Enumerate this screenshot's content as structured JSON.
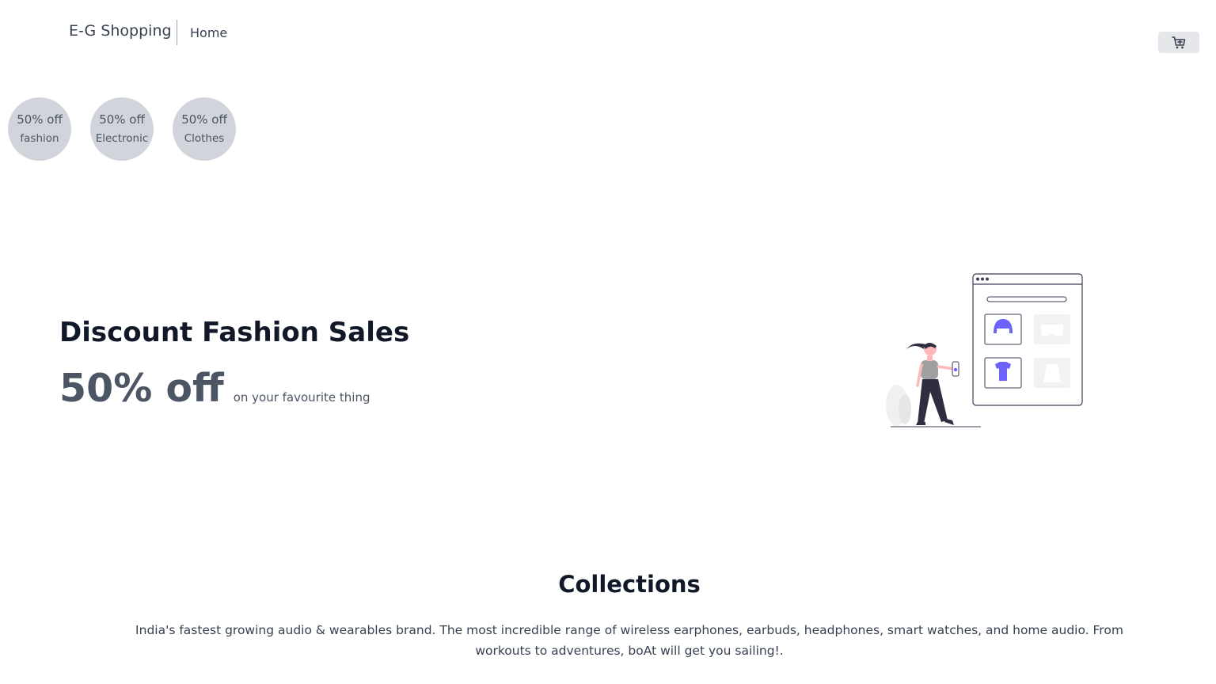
{
  "header": {
    "brand": "E-G Shopping",
    "nav": [
      {
        "label": "Home"
      }
    ],
    "cart_icon": "cart-plus-icon"
  },
  "discounts": [
    {
      "offer": "50% off",
      "category": "fashion"
    },
    {
      "offer": "50% off",
      "category": "Electronic"
    },
    {
      "offer": "50% off",
      "category": "Clothes"
    }
  ],
  "hero": {
    "title": "Discount Fashion Sales",
    "offer": "50% off",
    "offer_sub": "on your favourite thing",
    "accent_color": "#6c63ff"
  },
  "collections": {
    "title": "Collections",
    "description": "India's fastest growing audio & wearables brand. The most incredible range of wireless earphones, earbuds, headphones, smart watches, and home audio. From workouts to adventures, boAt will get you sailing!."
  }
}
